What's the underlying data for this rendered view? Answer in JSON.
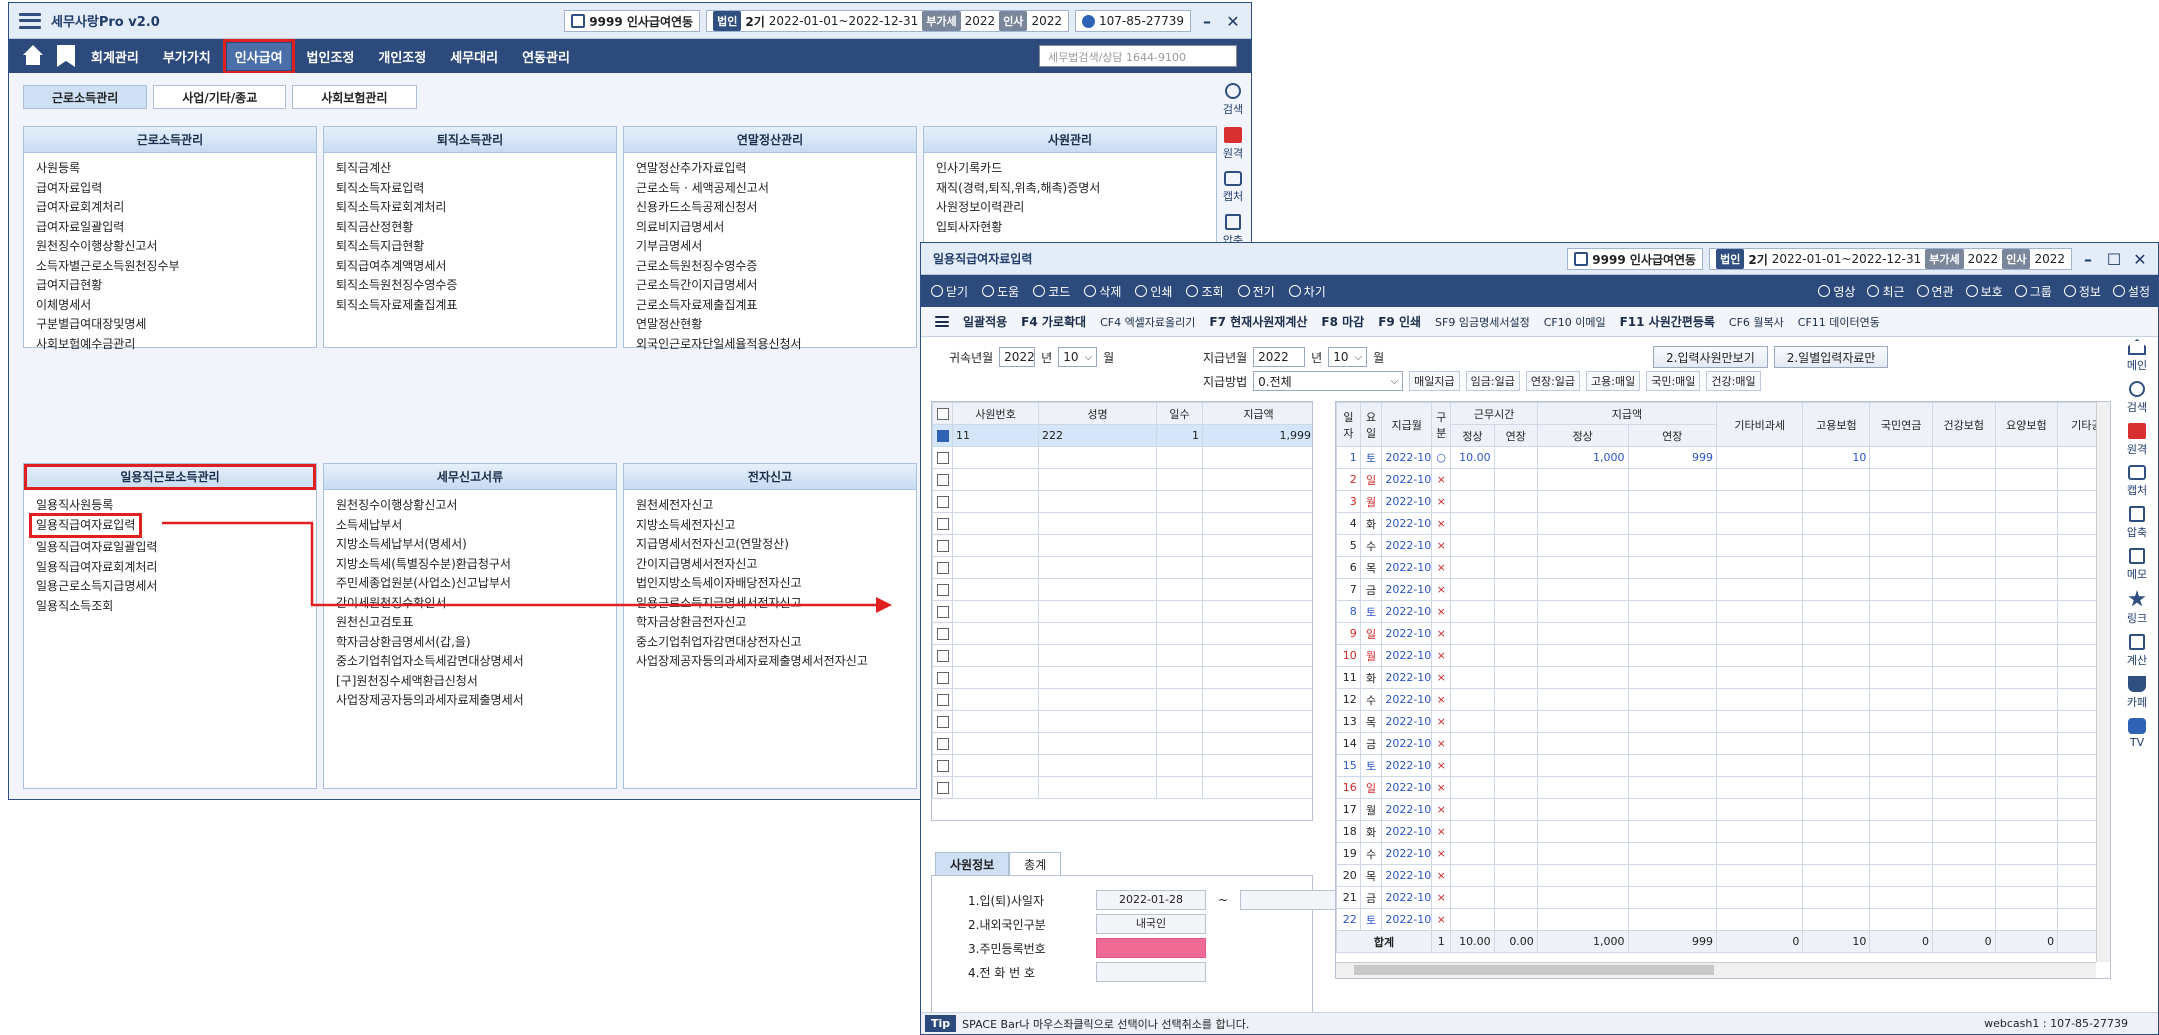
{
  "app": {
    "title": "세무사랑Pro v2.0",
    "company": "9999 인사급여연동",
    "corp_tag": "법인",
    "period_num": "2기",
    "period": "2022-01-01~2022-12-31",
    "vat_tag": "부가세",
    "vat_year": "2022",
    "hr_tag": "인사",
    "hr_year": "2022",
    "bizno": "107-85-27739"
  },
  "menu": {
    "items": [
      "회계관리",
      "부가가치",
      "인사급여",
      "법인조정",
      "개인조정",
      "세무대리",
      "연동관리"
    ],
    "active_index": 2,
    "search_placeholder": "세무법검색/상담 1644-9100"
  },
  "tabs": [
    "근로소득관리",
    "사업/기타/종교",
    "사회보험관리"
  ],
  "panels": [
    {
      "title": "근로소득관리",
      "items": [
        "사원등록",
        "급여자료입력",
        "급여자료회계처리",
        "급여자료일괄입력",
        "원천징수이행상황신고서",
        "소득자별근로소득원천징수부",
        "급여지급현황",
        "이체명세서",
        "구분별급여대장및명세",
        "사회보험예수금관리"
      ]
    },
    {
      "title": "퇴직소득관리",
      "items": [
        "퇴직금계산",
        "퇴직소득자료입력",
        "퇴직소득자료회계처리",
        "퇴직금산정현황",
        "퇴직소득지급현황",
        "퇴직급여추계액명세서",
        "퇴직소득원천징수영수증",
        "퇴직소득자료제출집계표"
      ]
    },
    {
      "title": "연말정산관리",
      "items": [
        "연말정산추가자료입력",
        "근로소득 · 세액공제신고서",
        "신용카드소득공제신청서",
        "의료비지급명세서",
        "기부금명세서",
        "근로소득원천징수영수증",
        "근로소득간이지급명세서",
        "근로소득자료제출집계표",
        "연말정산현황",
        "외국인근로자단일세율적용신청서"
      ]
    },
    {
      "title": "사원관리",
      "items": [
        "인사기록카드",
        "재직(경력,퇴직,위촉,해촉)증명서",
        "사원정보이력관리",
        "입퇴사자현황"
      ]
    },
    {
      "title": "일용직근로소득관리",
      "items": [
        "일용직사원등록",
        "일용직급여자료입력",
        "일용직급여자료일괄입력",
        "일용직급여자료회계처리",
        "일용근로소득지급명세서",
        "일용직소득조회"
      ]
    },
    {
      "title": "세무신고서류",
      "items": [
        "원천징수이행상황신고서",
        "소득세납부서",
        "지방소득세납부서(명세서)",
        "지방소득세(특별징수분)환급청구서",
        "주민세종업원분(사업소)신고납부서",
        "간이세원천징수확인서",
        "원천신고검토표",
        "학자금상환금명세서(갑,을)",
        "중소기업취업자소득세감면대상명세서",
        "[구]원천징수세액환급신청서",
        "사업장제공자등의과세자료제출명세서"
      ]
    },
    {
      "title": "전자신고",
      "items": [
        "원천세전자신고",
        "지방소득세전자신고",
        "지급명세서전자신고(연말정산)",
        "간이지급명세서전자신고",
        "법인지방소득세이자배당전자신고",
        "일용근로소득지급명세서전자신고",
        "학자금상환금전자신고",
        "중소기업취업자감면대상전자신고",
        "사업장제공자등의과세자료제출명세서전자신고"
      ]
    }
  ],
  "rail_main": [
    "검색",
    "원격",
    "캡처",
    "압축"
  ],
  "popup": {
    "title": "일용직급여자료입력",
    "company": "9999 인사급여연동",
    "corp_tag": "법인",
    "period_num": "2기",
    "period": "2022-01-01~2022-12-31",
    "vat_tag": "부가세",
    "vat_year": "2022",
    "hr_tag": "인사",
    "hr_year": "2022",
    "toolbar1": [
      "닫기",
      "도움",
      "코드",
      "삭제",
      "인쇄",
      "조회",
      "전기",
      "차기"
    ],
    "toolbar1_right": [
      "영상",
      "최근",
      "연관",
      "보호",
      "그룹",
      "정보",
      "설정"
    ],
    "toolbar2": [
      "일괄적용",
      "F4 가로확대",
      "CF4 엑셀자료올리기",
      "F7 현재사원재계산",
      "F8 마감",
      "F9 인쇄",
      "SF9 임금명세서설정",
      "CF10 이메일",
      "F11 사원간편등록",
      "CF6 월복사",
      "CF11 데이터연동"
    ],
    "filters": {
      "belong_label": "귀속년월",
      "belong_year": "2022",
      "year_unit": "년",
      "belong_month": "10",
      "month_unit": "월",
      "pay_label": "지급년월",
      "pay_year": "2022",
      "pay_month": "10",
      "method_label": "지급방법",
      "method_value": "0.전체",
      "chips": [
        "매일지급",
        "임금:일급",
        "연장:일급",
        "고용:매일",
        "국민:매일",
        "건강:매일"
      ],
      "btn1": "2.입력사원만보기",
      "btn2": "2.일별입력자료만"
    },
    "emp_table": {
      "headers": [
        "사원번호",
        "성명",
        "일수",
        "지급액"
      ],
      "rows": [
        [
          "11",
          "222",
          "1",
          "1,999"
        ]
      ]
    },
    "subtabs": [
      "사원정보",
      "총계"
    ],
    "info": [
      {
        "label": "1.입(퇴)사일자",
        "value": "2022-01-28",
        "extra": "~"
      },
      {
        "label": "2.내외국인구분",
        "value": "내국인"
      },
      {
        "label": "3.주민등록번호",
        "value": ""
      },
      {
        "label": "4.전 화 번 호",
        "value": ""
      }
    ],
    "day_table": {
      "h_day": "일자",
      "h_wd": "요일",
      "h_paydate": "지급월",
      "h_kind": "구분",
      "h_work": "근무시간",
      "h_pay": "지급액",
      "h_normal": "정상",
      "h_ext": "연장",
      "h_other": [
        "기타비과세",
        "고용보험",
        "국민연금",
        "건강보험",
        "요양보험",
        "기타공제액"
      ],
      "rows": [
        {
          "d": "1",
          "w": "토",
          "m": "2022-10",
          "k": "○",
          "n": "10.00",
          "e": "",
          "pn": "1,000",
          "pe": "999",
          "emp": "10",
          "c": "blue"
        },
        {
          "d": "2",
          "w": "일",
          "m": "2022-10",
          "k": "×",
          "c": "red"
        },
        {
          "d": "3",
          "w": "월",
          "m": "2022-10",
          "k": "×",
          "c": "red"
        },
        {
          "d": "4",
          "w": "화",
          "m": "2022-10",
          "k": "×",
          "c": ""
        },
        {
          "d": "5",
          "w": "수",
          "m": "2022-10",
          "k": "×",
          "c": ""
        },
        {
          "d": "6",
          "w": "목",
          "m": "2022-10",
          "k": "×",
          "c": ""
        },
        {
          "d": "7",
          "w": "금",
          "m": "2022-10",
          "k": "×",
          "c": ""
        },
        {
          "d": "8",
          "w": "토",
          "m": "2022-10",
          "k": "×",
          "c": "blue"
        },
        {
          "d": "9",
          "w": "일",
          "m": "2022-10",
          "k": "×",
          "c": "red"
        },
        {
          "d": "10",
          "w": "월",
          "m": "2022-10",
          "k": "×",
          "c": "red"
        },
        {
          "d": "11",
          "w": "화",
          "m": "2022-10",
          "k": "×",
          "c": ""
        },
        {
          "d": "12",
          "w": "수",
          "m": "2022-10",
          "k": "×",
          "c": ""
        },
        {
          "d": "13",
          "w": "목",
          "m": "2022-10",
          "k": "×",
          "c": ""
        },
        {
          "d": "14",
          "w": "금",
          "m": "2022-10",
          "k": "×",
          "c": ""
        },
        {
          "d": "15",
          "w": "토",
          "m": "2022-10",
          "k": "×",
          "c": "blue"
        },
        {
          "d": "16",
          "w": "일",
          "m": "2022-10",
          "k": "×",
          "c": "red"
        },
        {
          "d": "17",
          "w": "월",
          "m": "2022-10",
          "k": "×",
          "c": ""
        },
        {
          "d": "18",
          "w": "화",
          "m": "2022-10",
          "k": "×",
          "c": ""
        },
        {
          "d": "19",
          "w": "수",
          "m": "2022-10",
          "k": "×",
          "c": ""
        },
        {
          "d": "20",
          "w": "목",
          "m": "2022-10",
          "k": "×",
          "c": ""
        },
        {
          "d": "21",
          "w": "금",
          "m": "2022-10",
          "k": "×",
          "c": ""
        },
        {
          "d": "22",
          "w": "토",
          "m": "2022-10",
          "k": "×",
          "c": "blue"
        }
      ],
      "total": {
        "label": "합계",
        "cnt": "1",
        "n": "10.00",
        "e": "0.00",
        "pn": "1,000",
        "pe": "999",
        "v": [
          "0",
          "10",
          "0",
          "0",
          "0"
        ]
      }
    },
    "rail": [
      "메인",
      "검색",
      "원격",
      "캡처",
      "압축",
      "메모",
      "링크",
      "계산",
      "카페",
      "TV"
    ],
    "status_tip": "Tip",
    "status_text": "SPACE Bar나 마우스좌클릭으로 선택이나 선택취소를 합니다.",
    "status_user": "webcash1 : 107-85-27739"
  }
}
